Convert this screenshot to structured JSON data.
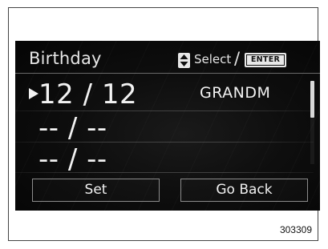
{
  "screen": {
    "title": "Birthday",
    "hint": {
      "icon": "up-down-arrows-icon",
      "select_label": "Select",
      "slash": "/",
      "enter_key": "ENTER"
    },
    "rows": [
      {
        "date": "12 / 12",
        "name": "GRANDM",
        "selected": true
      },
      {
        "date": "-- / --",
        "name": "",
        "selected": false
      },
      {
        "date": "-- / --",
        "name": "",
        "selected": false
      }
    ],
    "scrollbar": {
      "position": 0.0,
      "visible_fraction": 0.44
    },
    "buttons": {
      "set": "Set",
      "go_back": "Go Back"
    }
  },
  "figure_number": "303309",
  "colors": {
    "screen_bg": "#0e0e0e",
    "text": "#f2f2f2",
    "border": "#8c8c8c"
  }
}
